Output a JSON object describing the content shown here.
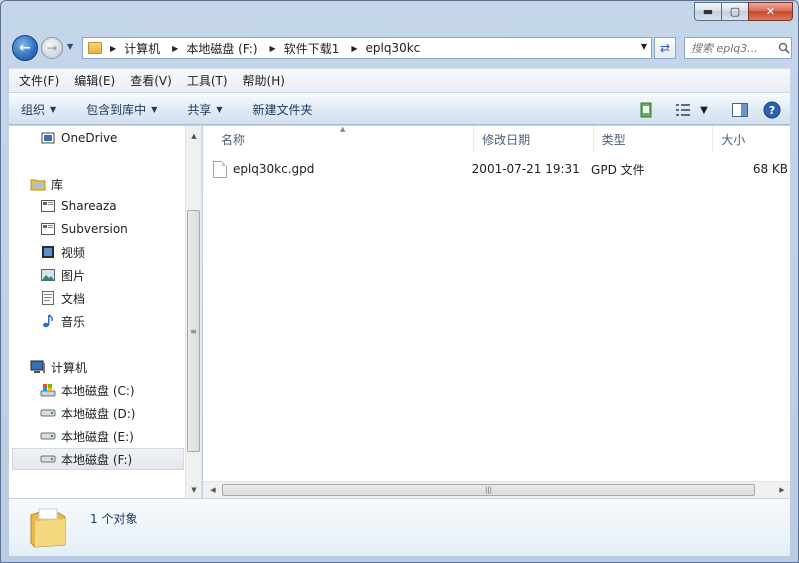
{
  "window": {
    "caption": {
      "minimize": "▬",
      "maximize": "▢",
      "close": "✕"
    }
  },
  "address": {
    "crumbs": [
      "计算机",
      "本地磁盘 (F:)",
      "软件下载1",
      "eplq30kc"
    ]
  },
  "search": {
    "placeholder": "搜索 eplq3..."
  },
  "menu": [
    "文件(F)",
    "编辑(E)",
    "查看(V)",
    "工具(T)",
    "帮助(H)"
  ],
  "toolbar": {
    "organize": "组织",
    "include_in_library": "包含到库中",
    "share": "共享",
    "new_folder": "新建文件夹"
  },
  "navigation": {
    "items": [
      {
        "label": "OneDrive",
        "icon": "onedrive-icon"
      },
      {
        "label": "库",
        "icon": "library-icon"
      },
      {
        "label": "Shareaza",
        "icon": "library-folder-icon"
      },
      {
        "label": "Subversion",
        "icon": "library-folder-icon"
      },
      {
        "label": "视频",
        "icon": "video-icon"
      },
      {
        "label": "图片",
        "icon": "picture-icon"
      },
      {
        "label": "文档",
        "icon": "document-icon"
      },
      {
        "label": "音乐",
        "icon": "music-icon"
      },
      {
        "label": "计算机",
        "icon": "computer-icon"
      },
      {
        "label": "本地磁盘 (C:)",
        "icon": "system-drive-icon"
      },
      {
        "label": "本地磁盘 (D:)",
        "icon": "drive-icon"
      },
      {
        "label": "本地磁盘 (E:)",
        "icon": "drive-icon"
      },
      {
        "label": "本地磁盘 (F:)",
        "icon": "drive-icon",
        "selected": true
      }
    ]
  },
  "columns": {
    "name": "名称",
    "modified": "修改日期",
    "type": "类型",
    "size": "大小"
  },
  "files": [
    {
      "name": "eplq30kc.gpd",
      "modified": "2001-07-21 19:31",
      "type": "GPD 文件",
      "size": "68 KB"
    }
  ],
  "details": {
    "count": "1 个对象"
  },
  "colors": {
    "accent": "#1e395b",
    "window_frame": "#c5d6ea"
  }
}
